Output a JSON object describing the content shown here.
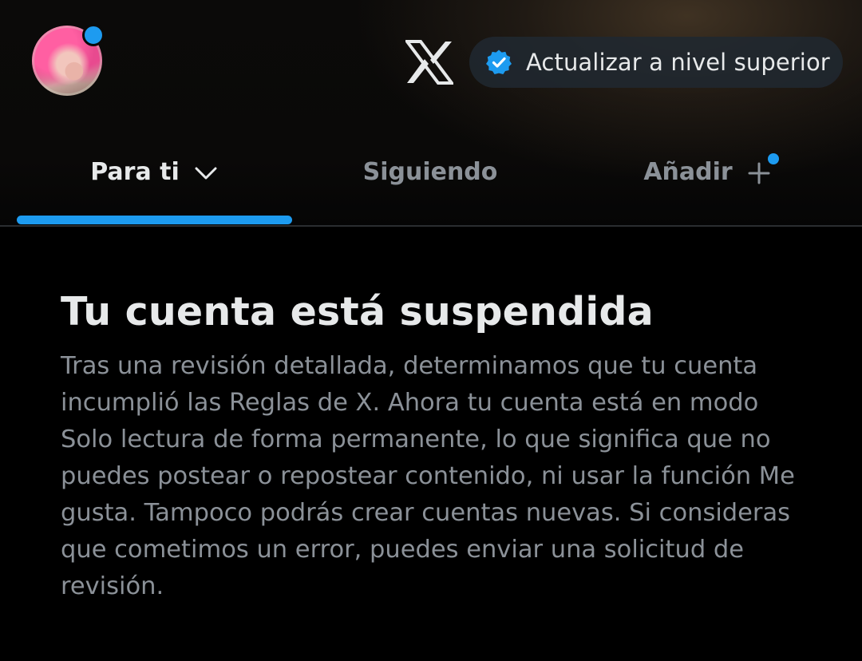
{
  "header": {
    "avatar_icon": "user-avatar",
    "notification_dot_color": "#1d9bf0",
    "logo_icon": "x-logo-icon",
    "upgrade_label": "Actualizar a nivel superior",
    "upgrade_icon": "verified-badge-icon"
  },
  "tabs": [
    {
      "label": "Para ti",
      "active": true,
      "icon": "chevron-down-icon"
    },
    {
      "label": "Siguiendo",
      "active": false
    },
    {
      "label": "Añadir",
      "active": false,
      "icon": "plus-icon"
    }
  ],
  "notice": {
    "title": "Tu cuenta está suspendida",
    "body": "Tras una revisión detallada, determinamos que tu cuenta incumplió las Reglas de X. Ahora tu cuenta está en modo Solo lectura de forma permanente, lo que significa que no puedes postear o repostear contenido, ni usar la función Me gusta. Tampoco podrás crear cuentas nuevas. Si consideras que cometimos un error, puedes enviar una solicitud de revisión."
  },
  "colors": {
    "accent": "#1d9bf0",
    "background": "#000000",
    "text_primary": "#e7e9ea",
    "text_secondary": "#8b9198"
  }
}
